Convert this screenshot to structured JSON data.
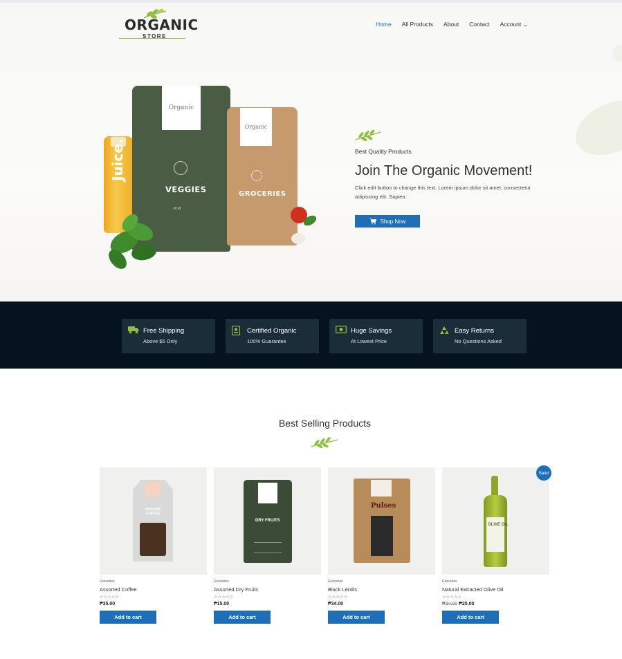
{
  "brand": {
    "logo_word": "ORGANIC",
    "logo_sub": "STORE",
    "colors": {
      "accent": "#1e6fb8",
      "leaf": "#8fbf3f",
      "dark_band": "#04131f",
      "feature_card": "#1c2d3a"
    }
  },
  "nav": {
    "items": [
      "Home",
      "All Products",
      "About",
      "Contact",
      "Account"
    ],
    "active": "Home",
    "account_chevron": "chevron-down-icon"
  },
  "hero": {
    "eyebrow": "Best Quality Products",
    "headline": "Join The Organic Movement!",
    "description": "Click edit button to change this text. Lorem ipsum dolor sit amet, consectetur adipiscing elit. Sapien.",
    "button_label": "Shop Now",
    "button_icon": "cart-icon",
    "image": {
      "juice_text": "Juice.",
      "bag1_tag": "Organic",
      "bag1_label": "VEGGIES",
      "bag2_tag": "Organic",
      "bag2_label": "GROCERIES"
    }
  },
  "features": [
    {
      "title": "Free Shipping",
      "subtitle": "Above $5 Only",
      "icon": "truck-icon"
    },
    {
      "title": "Certified Organic",
      "subtitle": "100% Guarantee",
      "icon": "certificate-icon"
    },
    {
      "title": "Huge Savings",
      "subtitle": "At Lowest Price",
      "icon": "money-icon"
    },
    {
      "title": "Easy Returns",
      "subtitle": "No Questions Asked",
      "icon": "recycle-icon"
    }
  ],
  "best_selling": {
    "title": "Best Selling Products",
    "products": [
      {
        "category": "Groceries",
        "name": "Assorted Coffee",
        "price": "₱35.00",
        "old_price": "",
        "rating_stars": "☆☆☆☆☆",
        "button": "Add to cart",
        "sale": false,
        "image_label": "ORGANIC COFFEE"
      },
      {
        "category": "Groceries",
        "name": "Assorted Dry Fruits",
        "price": "₱15.00",
        "old_price": "",
        "rating_stars": "☆☆☆☆☆",
        "button": "Add to cart",
        "sale": false,
        "image_label": "DRY FRUITS"
      },
      {
        "category": "Groceries",
        "name": "Black Lentils",
        "price": "₱34.00",
        "old_price": "",
        "rating_stars": "☆☆☆☆☆",
        "button": "Add to cart",
        "sale": false,
        "image_label": "Pulses"
      },
      {
        "category": "Groceries",
        "name": "Natural Extracted Olive Oil",
        "price": "₱25.00",
        "old_price": "₱34.00",
        "rating_stars": "☆☆☆☆☆",
        "button": "Add to cart",
        "sale": true,
        "image_label": "OLIVE OIL"
      }
    ],
    "sale_badge": "Sale!"
  }
}
